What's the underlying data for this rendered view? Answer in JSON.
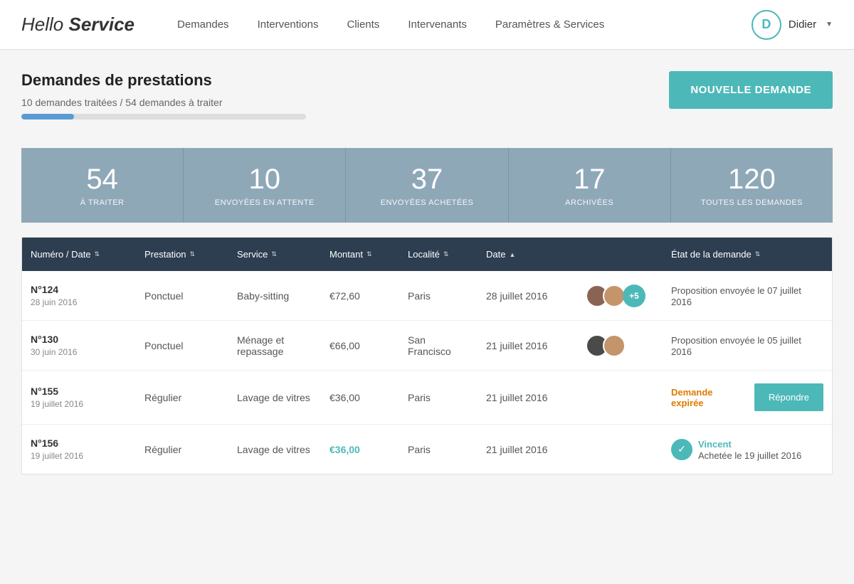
{
  "navbar": {
    "logo_hello": "Hello ",
    "logo_service": "Service",
    "links": [
      {
        "id": "demandes",
        "label": "Demandes"
      },
      {
        "id": "interventions",
        "label": "Interventions"
      },
      {
        "id": "clients",
        "label": "Clients"
      },
      {
        "id": "intervenants",
        "label": "Intervenants"
      },
      {
        "id": "parametres",
        "label": "Paramètres & Services"
      }
    ],
    "user_initial": "D",
    "user_name": "Didier"
  },
  "page": {
    "title": "Demandes de prestations",
    "progress_label": "10 demandes traitées / 54 demandes à traiter",
    "progress_percent": 18.5,
    "btn_new": "NOUVELLE DEMANDE"
  },
  "stats": [
    {
      "number": "54",
      "label": "À TRAITER"
    },
    {
      "number": "10",
      "label": "ENVOYÉES EN ATTENTE"
    },
    {
      "number": "37",
      "label": "ENVOYÉES ACHETÉES"
    },
    {
      "number": "17",
      "label": "ARCHIVÉES"
    },
    {
      "number": "120",
      "label": "TOUTES LES DEMANDES"
    }
  ],
  "table": {
    "columns": [
      {
        "id": "num",
        "label": "Numéro / Date",
        "sort": "arrows"
      },
      {
        "id": "prest",
        "label": "Prestation",
        "sort": "arrows"
      },
      {
        "id": "service",
        "label": "Service",
        "sort": "arrows"
      },
      {
        "id": "montant",
        "label": "Montant",
        "sort": "arrows"
      },
      {
        "id": "localite",
        "label": "Localité",
        "sort": "arrows"
      },
      {
        "id": "date",
        "label": "Date",
        "sort": "up"
      },
      {
        "id": "intervenants",
        "label": ""
      },
      {
        "id": "etat",
        "label": "État de la demande",
        "sort": "arrows"
      }
    ],
    "rows": [
      {
        "num": "N°124",
        "date_created": "28 juin 2016",
        "prestation": "Ponctuel",
        "service": "Baby-sitting",
        "montant": "€72,60",
        "montant_style": "normal",
        "localite": "Paris",
        "date": "28 juillet 2016",
        "avatars": [
          "brown",
          "light-brown"
        ],
        "avatar_plus": "+5",
        "etat_type": "proposition",
        "etat_text": "Proposition envoyée le 07 juillet 2016"
      },
      {
        "num": "N°130",
        "date_created": "30 juin 2016",
        "prestation": "Ponctuel",
        "service": "Ménage et repassage",
        "montant": "€66,00",
        "montant_style": "normal",
        "localite": "San Francisco",
        "date": "21 juillet 2016",
        "avatars": [
          "dark",
          "light-brown"
        ],
        "avatar_plus": null,
        "etat_type": "proposition",
        "etat_text": "Proposition envoyée le 05 juillet 2016"
      },
      {
        "num": "N°155",
        "date_created": "19 juillet 2016",
        "prestation": "Régulier",
        "service": "Lavage de vitres",
        "montant": "€36,00",
        "montant_style": "normal",
        "localite": "Paris",
        "date": "21 juillet 2016",
        "avatars": [],
        "avatar_plus": null,
        "etat_type": "expired",
        "etat_text": "Demande expirée",
        "btn_repondre": "Répondre"
      },
      {
        "num": "N°156",
        "date_created": "19 juillet 2016",
        "prestation": "Régulier",
        "service": "Lavage de vitres",
        "montant": "€36,00",
        "montant_style": "blue",
        "localite": "Paris",
        "date": "21 juillet 2016",
        "avatars": [],
        "avatar_plus": null,
        "etat_type": "achetee",
        "etat_person": "Vincent",
        "etat_text": "Achetée le 19 juillet 2016"
      }
    ]
  }
}
